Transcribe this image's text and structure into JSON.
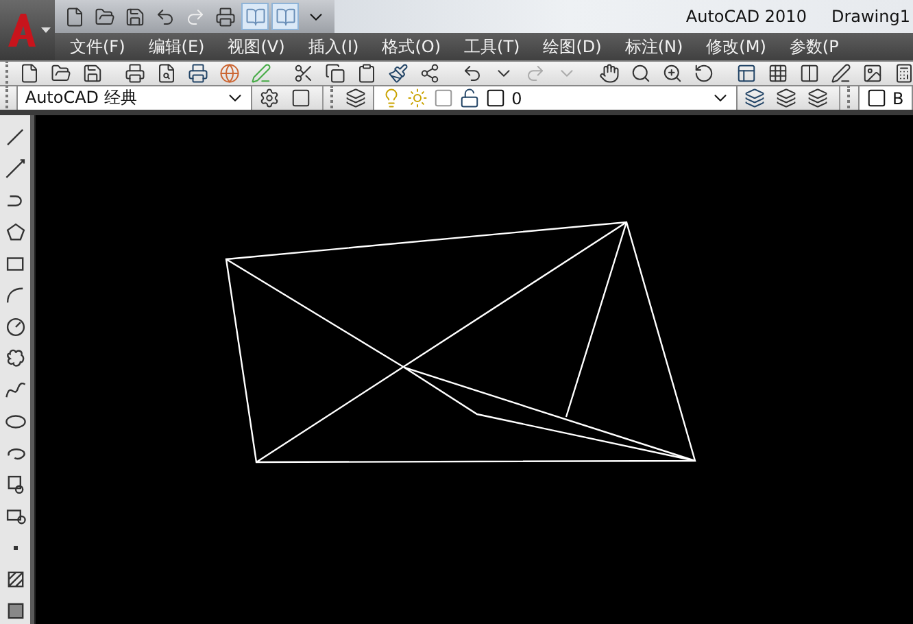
{
  "window": {
    "app_title": "AutoCAD 2010",
    "document_title": "Drawing1"
  },
  "menu": [
    {
      "label": "文件(F)"
    },
    {
      "label": "编辑(E)"
    },
    {
      "label": "视图(V)"
    },
    {
      "label": "插入(I)"
    },
    {
      "label": "格式(O)"
    },
    {
      "label": "工具(T)"
    },
    {
      "label": "绘图(D)"
    },
    {
      "label": "标注(N)"
    },
    {
      "label": "修改(M)"
    },
    {
      "label": "参数(P"
    }
  ],
  "workspace": {
    "value": "AutoCAD 经典"
  },
  "layer": {
    "value": "0"
  },
  "color": {
    "value": "B"
  }
}
